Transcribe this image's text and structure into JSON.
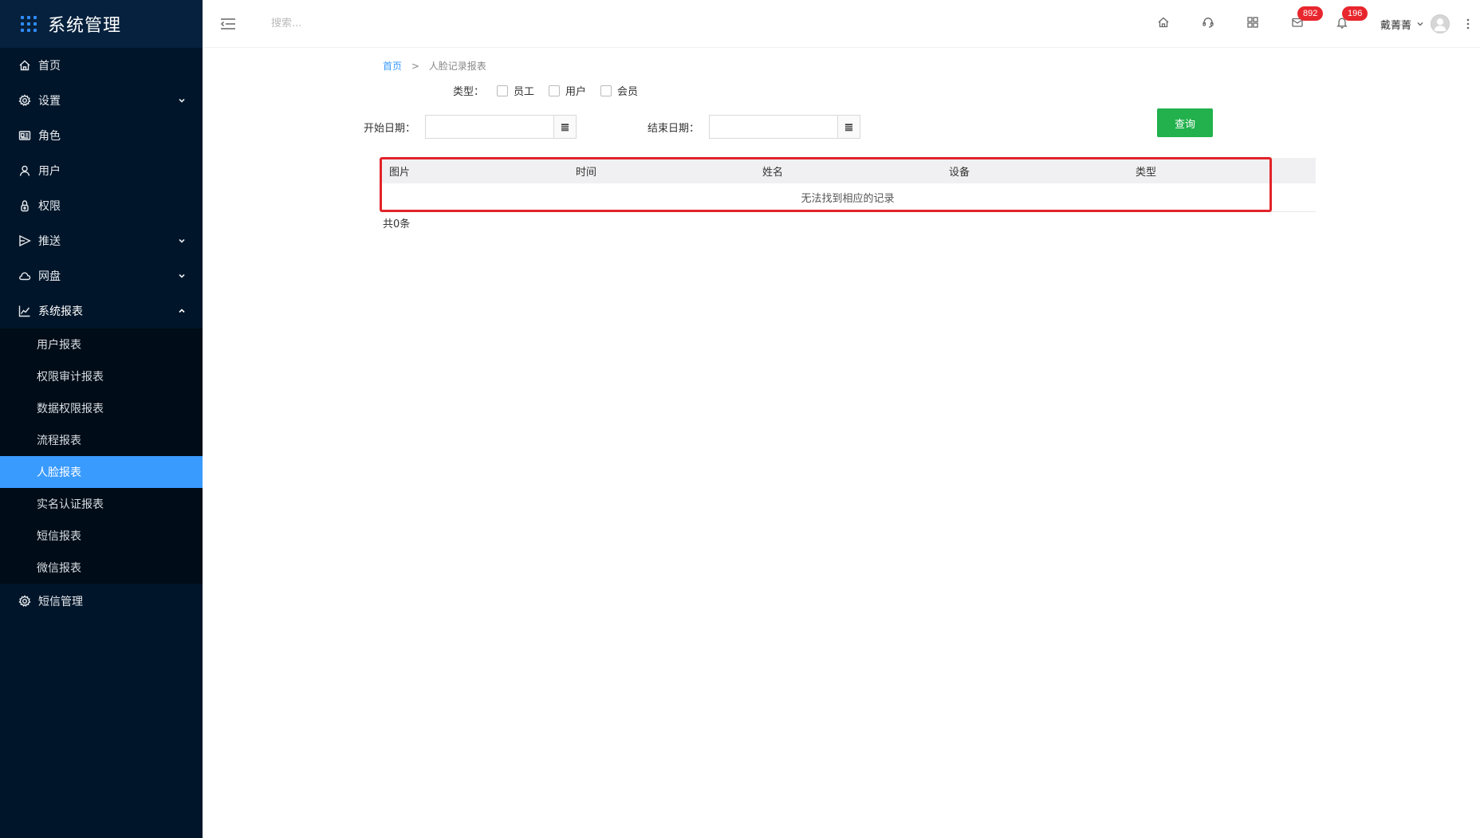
{
  "app": {
    "title": "系统管理"
  },
  "sidebar": {
    "items": [
      {
        "label": "首页",
        "icon": "home-icon"
      },
      {
        "label": "设置",
        "icon": "gear-icon",
        "arrow": "down"
      },
      {
        "label": "角色",
        "icon": "id-card-icon"
      },
      {
        "label": "用户",
        "icon": "user-icon"
      },
      {
        "label": "权限",
        "icon": "lock-icon"
      },
      {
        "label": "推送",
        "icon": "send-icon",
        "arrow": "down"
      },
      {
        "label": "网盘",
        "icon": "cloud-icon",
        "arrow": "down"
      },
      {
        "label": "系统报表",
        "icon": "line-chart-icon",
        "arrow": "up"
      }
    ],
    "report_sub": [
      "用户报表",
      "权限审计报表",
      "数据权限报表",
      "流程报表",
      "人脸报表",
      "实名认证报表",
      "短信报表",
      "微信报表"
    ],
    "active_sub": "人脸报表",
    "last_item": {
      "label": "短信管理",
      "icon": "gear-icon"
    }
  },
  "header": {
    "search_placeholder": "搜索...",
    "mail_badge": "892",
    "bell_badge": "196",
    "user_name": "戴菁菁"
  },
  "breadcrumb": {
    "home": "首页",
    "separator": ">",
    "current": "人脸记录报表"
  },
  "filters": {
    "type_label": "类型：",
    "type_options": [
      "员工",
      "用户",
      "会员"
    ],
    "start_label": "开始日期：",
    "end_label": "结束日期：",
    "start_value": "",
    "end_value": "",
    "query_label": "查询"
  },
  "table": {
    "columns": [
      "图片",
      "时间",
      "姓名",
      "设备",
      "类型"
    ],
    "empty_text": "无法找到相应的记录",
    "total_text": "共0条"
  },
  "colors": {
    "sidebar_bg": "#001529",
    "active": "#3a9bff",
    "query_btn": "#22b14c",
    "badge": "#e8262d",
    "highlight": "#e2232a"
  }
}
